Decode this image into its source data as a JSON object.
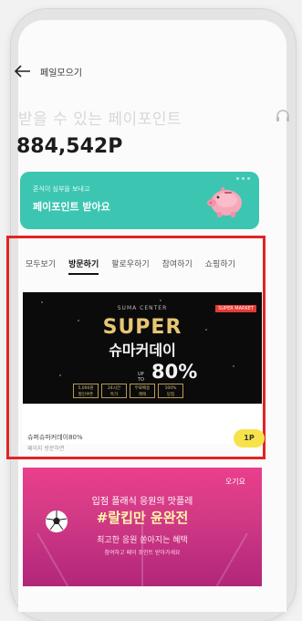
{
  "header": {
    "title": "페일모으기"
  },
  "subtitle": "받을 수 있는 페이포인트",
  "points": "884,542P",
  "banner": {
    "sub": "혼식이 심부을 보내고",
    "title": "페이포인트 받아요"
  },
  "tabs": [
    "모두보기",
    "방문하기",
    "팔로우하기",
    "참여하기",
    "쇼핑하기"
  ],
  "ad": {
    "topline": "SUMA CENTER",
    "badge": "SUPER MARKET",
    "super": "SUPER",
    "name": "슈마커데이",
    "upto": "UP TO",
    "pct": "80%",
    "stats": [
      {
        "value": "5,000원",
        "label": "할인쿠폰"
      },
      {
        "value": "24시간",
        "label": "특가"
      },
      {
        "value": "무료배송",
        "label": "혜택"
      },
      {
        "value": "100%",
        "label": "당첨"
      }
    ],
    "info_title": "슈퍼슈마커데이80%",
    "info_sub": "페이지 방문하면",
    "point": "1P"
  },
  "card2": {
    "label": "오기요",
    "line1": "입점 플래식 응원의 맛플레",
    "line2": "#랄킵만 윤완전",
    "line3": "최고한 응원 쏟아지는 혜택",
    "line4": "참여하고 페이 포인트 받아가세요"
  },
  "colors": {
    "banner": "#3cc6b2",
    "highlight": "#e02424",
    "point_badge": "#f6e34a"
  }
}
